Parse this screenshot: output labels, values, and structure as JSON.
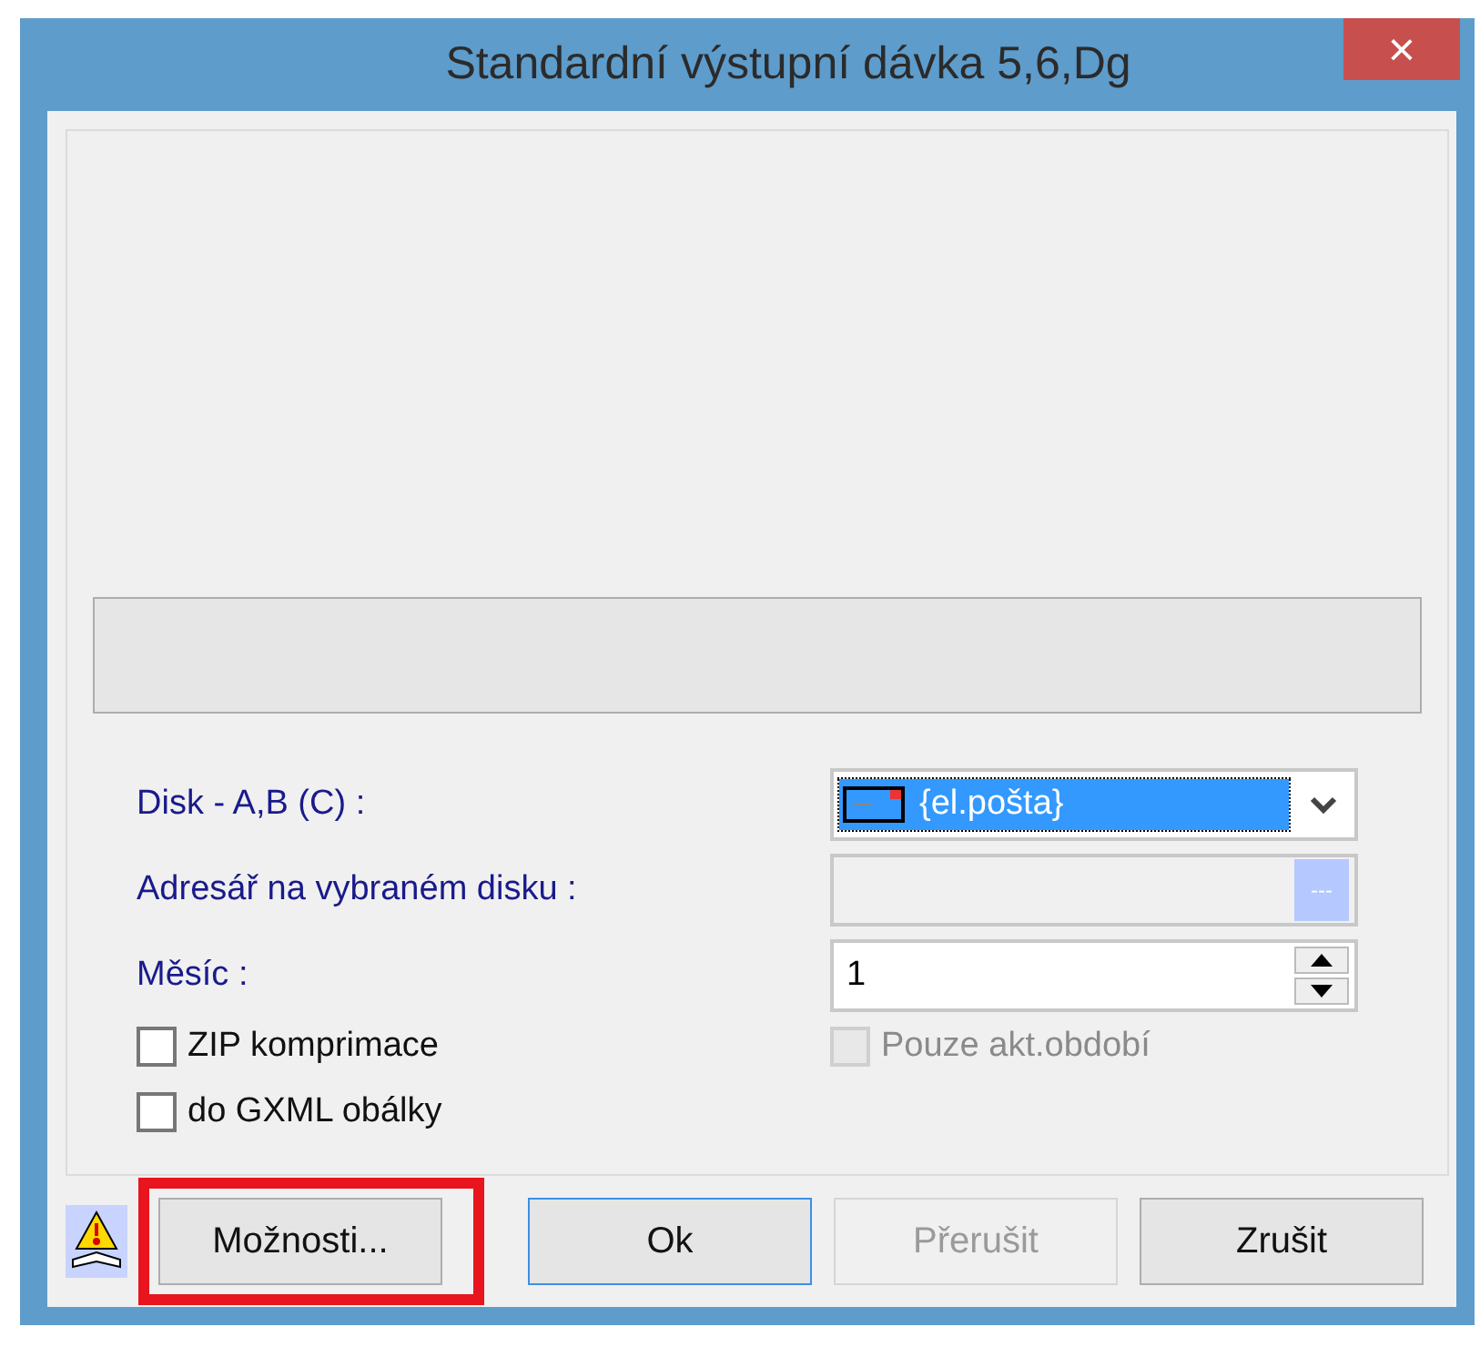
{
  "window": {
    "title": "Standardní výstupní dávka 5,6,Dg",
    "close": "×"
  },
  "fields": [
    {
      "kind": "combo",
      "label": "Disk - A,B (C) :",
      "value": "{el.pošta}",
      "disabled": false
    },
    {
      "kind": "browse",
      "label": "Adresář na vybraném disku :",
      "disabled": true,
      "button": "---"
    },
    {
      "kind": "spin",
      "label": "Měsíc :",
      "value": "1",
      "disabled": false
    }
  ],
  "checkboxes": [
    {
      "label": "ZIP komprimace",
      "checked": false,
      "disabled": false
    },
    {
      "label": "Pouze akt.období",
      "checked": false,
      "disabled": true
    },
    {
      "label": "do GXML obálky",
      "checked": false,
      "disabled": false
    }
  ],
  "buttons": [
    {
      "label": "Možnosti...",
      "default": false,
      "disabled": false,
      "highlighted": true
    },
    {
      "label": "Ok",
      "default": true,
      "disabled": false,
      "highlighted": false
    },
    {
      "label": "Přerušit",
      "default": false,
      "disabled": true,
      "highlighted": false
    },
    {
      "label": "Zrušit",
      "default": false,
      "disabled": false,
      "highlighted": false
    }
  ]
}
